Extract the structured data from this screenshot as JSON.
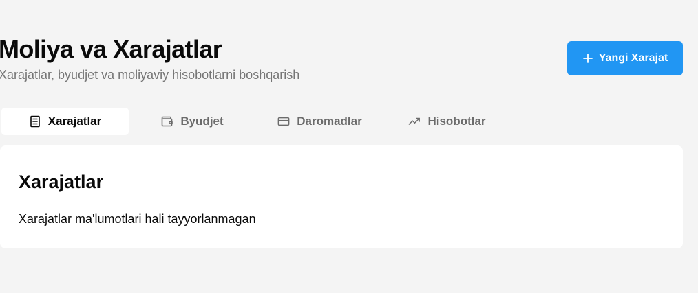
{
  "header": {
    "title": "Moliya va Xarajatlar",
    "subtitle": "Xarajatlar, byudjet va moliyaviy hisobotlarni boshqarish",
    "new_expense_button": {
      "label": "Yangi Xarajat",
      "icon": "plus-icon",
      "color": "#2196f3"
    }
  },
  "tabs": [
    {
      "label": "Xarajatlar",
      "icon": "document-icon",
      "active": true
    },
    {
      "label": "Byudjet",
      "icon": "wallet-icon",
      "active": false
    },
    {
      "label": "Daromadlar",
      "icon": "credit-card-icon",
      "active": false
    },
    {
      "label": "Hisobotlar",
      "icon": "trending-up-icon",
      "active": false
    }
  ],
  "content": {
    "title": "Xarajatlar",
    "message": "Xarajatlar ma'lumotlari hali tayyorlanmagan"
  }
}
